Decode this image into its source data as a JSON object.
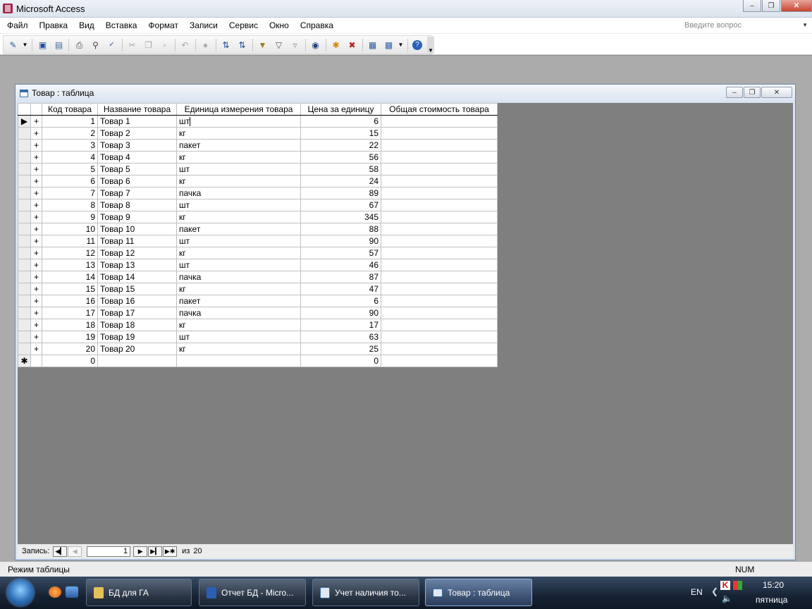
{
  "app": {
    "title": "Microsoft Access",
    "window_buttons": {
      "minimize": "–",
      "restore": "❐",
      "close": "✕"
    }
  },
  "menu": {
    "items": [
      "Файл",
      "Правка",
      "Вид",
      "Вставка",
      "Формат",
      "Записи",
      "Сервис",
      "Окно",
      "Справка"
    ],
    "help_placeholder": "Введите вопрос"
  },
  "toolbar": {
    "icons": [
      "view-icon",
      "save-icon",
      "search-file-icon",
      "print-icon",
      "print-preview-icon",
      "spelling-icon",
      "cut-icon",
      "copy-icon",
      "paste-icon",
      "undo-icon",
      "hyperlink-icon",
      "sort-ascending-icon",
      "sort-descending-icon",
      "filter-by-selection-icon",
      "filter-by-form-icon",
      "apply-filter-icon",
      "find-icon",
      "new-record-icon",
      "delete-record-icon",
      "database-window-icon",
      "new-object-icon",
      "help-icon"
    ]
  },
  "child_window": {
    "title": "Товар : таблица",
    "columns": [
      "Код товара",
      "Название товара",
      "Единица измерения товара",
      "Цена за единицу",
      "Общая стоимость товара"
    ],
    "rows": [
      {
        "code": "1",
        "name": "Товар 1",
        "unit": "шт",
        "price": "6",
        "total": ""
      },
      {
        "code": "2",
        "name": "Товар 2",
        "unit": "кг",
        "price": "15",
        "total": ""
      },
      {
        "code": "3",
        "name": "Товар 3",
        "unit": "пакет",
        "price": "22",
        "total": ""
      },
      {
        "code": "4",
        "name": "Товар 4",
        "unit": "кг",
        "price": "56",
        "total": ""
      },
      {
        "code": "5",
        "name": "Товар 5",
        "unit": "шт",
        "price": "58",
        "total": ""
      },
      {
        "code": "6",
        "name": "Товар 6",
        "unit": "кг",
        "price": "24",
        "total": ""
      },
      {
        "code": "7",
        "name": "Товар 7",
        "unit": "пачка",
        "price": "89",
        "total": ""
      },
      {
        "code": "8",
        "name": "Товар 8",
        "unit": "шт",
        "price": "67",
        "total": ""
      },
      {
        "code": "9",
        "name": "Товар 9",
        "unit": "кг",
        "price": "345",
        "total": ""
      },
      {
        "code": "10",
        "name": "Товар 10",
        "unit": "пакет",
        "price": "88",
        "total": ""
      },
      {
        "code": "11",
        "name": "Товар 11",
        "unit": "шт",
        "price": "90",
        "total": ""
      },
      {
        "code": "12",
        "name": "Товар 12",
        "unit": "кг",
        "price": "57",
        "total": ""
      },
      {
        "code": "13",
        "name": "Товар 13",
        "unit": "шт",
        "price": "46",
        "total": ""
      },
      {
        "code": "14",
        "name": "Товар 14",
        "unit": "пачка",
        "price": "87",
        "total": ""
      },
      {
        "code": "15",
        "name": "Товар 15",
        "unit": "кг",
        "price": "47",
        "total": ""
      },
      {
        "code": "16",
        "name": "Товар 16",
        "unit": "пакет",
        "price": "6",
        "total": ""
      },
      {
        "code": "17",
        "name": "Товар 17",
        "unit": "пачка",
        "price": "90",
        "total": ""
      },
      {
        "code": "18",
        "name": "Товар 18",
        "unit": "кг",
        "price": "17",
        "total": ""
      },
      {
        "code": "19",
        "name": "Товар 19",
        "unit": "шт",
        "price": "63",
        "total": ""
      },
      {
        "code": "20",
        "name": "Товар 20",
        "unit": "кг",
        "price": "25",
        "total": ""
      }
    ],
    "new_row": {
      "code": "0",
      "price": "0"
    },
    "current_row_marker": "▶",
    "new_row_marker": "✱",
    "expand_marker": "+",
    "navigation": {
      "label": "Запись:",
      "current": "1",
      "of_label": "из",
      "total": "20"
    }
  },
  "statusbar": {
    "mode": "Режим таблицы",
    "num": "NUM"
  },
  "taskbar": {
    "tasks": [
      "БД для ГА",
      "Отчет БД - Micro...",
      "Учет наличия то...",
      "Товар : таблица"
    ],
    "active_index": 3,
    "language": "EN",
    "time": "15:20",
    "day": "пятница"
  }
}
